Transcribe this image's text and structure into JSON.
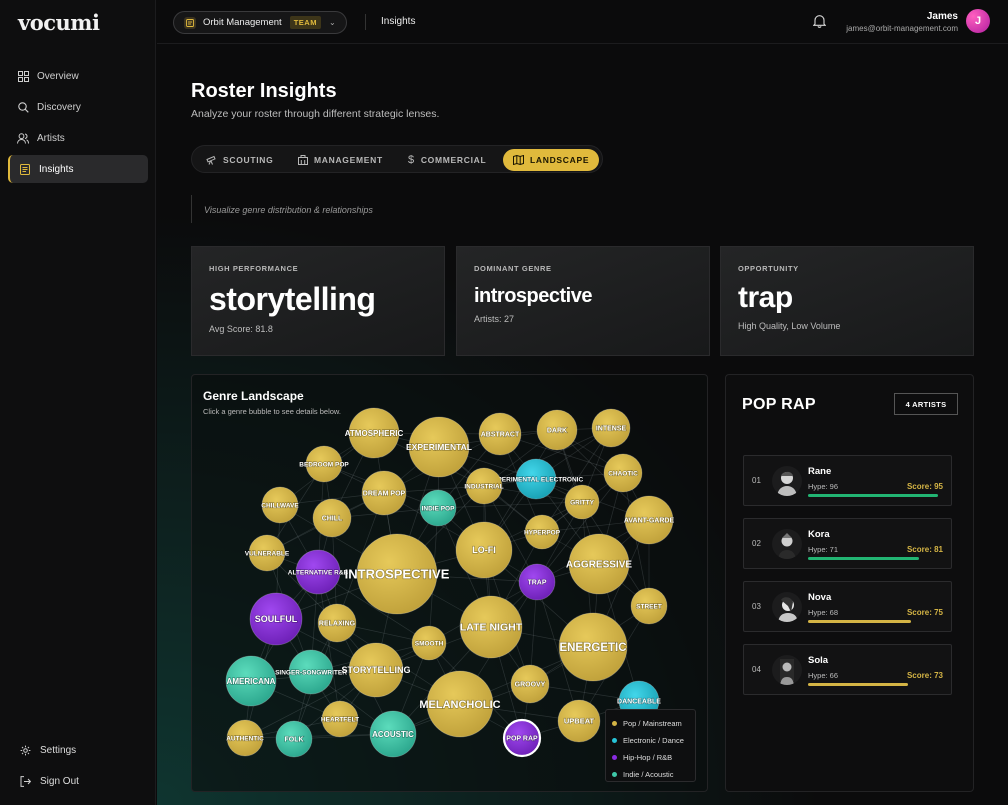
{
  "app": {
    "logo": "vocumi"
  },
  "sidebar": {
    "items": [
      {
        "label": "Overview",
        "icon": "grid-icon"
      },
      {
        "label": "Discovery",
        "icon": "search-icon"
      },
      {
        "label": "Artists",
        "icon": "users-icon"
      },
      {
        "label": "Insights",
        "icon": "document-icon",
        "active": true
      }
    ],
    "settings_label": "Settings",
    "signout_label": "Sign Out"
  },
  "header": {
    "org_name": "Orbit Management",
    "org_badge": "TEAM",
    "breadcrumb": "Insights",
    "user_name": "James",
    "user_email": "james@orbit-management.com",
    "avatar_initial": "J"
  },
  "page": {
    "title": "Roster Insights",
    "subtitle": "Analyze your roster through different strategic lenses.",
    "lens_description": "Visualize genre distribution & relationships"
  },
  "tabs": [
    {
      "label": "SCOUTING",
      "icon": "telescope-icon"
    },
    {
      "label": "MANAGEMENT",
      "icon": "building-icon"
    },
    {
      "label": "COMMERCIAL",
      "icon": "dollar-icon"
    },
    {
      "label": "LANDSCAPE",
      "icon": "map-icon",
      "active": true
    }
  ],
  "stats": [
    {
      "label": "HIGH PERFORMANCE",
      "value": "storytelling",
      "meta": "Avg Score: 81.8"
    },
    {
      "label": "DOMINANT GENRE",
      "value": "introspective",
      "meta": "Artists: 27"
    },
    {
      "label": "OPPORTUNITY",
      "value": "trap",
      "meta": "High Quality, Low Volume"
    }
  ],
  "landscape": {
    "title": "Genre Landscape",
    "subtitle": "Click a genre bubble to see details below.",
    "legend": [
      {
        "label": "Pop / Mainstream",
        "color": "#d4b445"
      },
      {
        "label": "Electronic / Dance",
        "color": "#27c4d8"
      },
      {
        "label": "Hip-Hop / R&B",
        "color": "#8a2be2"
      },
      {
        "label": "Indie / Acoustic",
        "color": "#3fc8a8"
      }
    ],
    "selected": "POP RAP",
    "bubbles": [
      {
        "label": "ATMOSPHERIC",
        "group": "pop"
      },
      {
        "label": "EXPERIMENTAL",
        "group": "pop"
      },
      {
        "label": "ABSTRACT",
        "group": "pop"
      },
      {
        "label": "DARK",
        "group": "pop"
      },
      {
        "label": "INTENSE",
        "group": "pop"
      },
      {
        "label": "BEDROOM POP",
        "group": "pop"
      },
      {
        "label": "EXPERIMENTAL ELECTRONIC",
        "group": "electronic"
      },
      {
        "label": "INDUSTRIAL",
        "group": "pop"
      },
      {
        "label": "CHAOTIC",
        "group": "pop"
      },
      {
        "label": "DREAM POP",
        "group": "pop"
      },
      {
        "label": "CHILLWAVE",
        "group": "pop"
      },
      {
        "label": "CHILL",
        "group": "pop"
      },
      {
        "label": "INDIE POP",
        "group": "indie"
      },
      {
        "label": "GRITTY",
        "group": "pop"
      },
      {
        "label": "AVANT-GARDE",
        "group": "pop"
      },
      {
        "label": "HYPERPOP",
        "group": "pop"
      },
      {
        "label": "LO-FI",
        "group": "pop"
      },
      {
        "label": "VULNERABLE",
        "group": "pop"
      },
      {
        "label": "ALTERNATIVE R&B",
        "group": "hiphop"
      },
      {
        "label": "INTROSPECTIVE",
        "group": "pop"
      },
      {
        "label": "AGGRESSIVE",
        "group": "pop"
      },
      {
        "label": "TRAP",
        "group": "hiphop"
      },
      {
        "label": "SOULFUL",
        "group": "hiphop"
      },
      {
        "label": "RELAXING",
        "group": "pop"
      },
      {
        "label": "STREET",
        "group": "pop"
      },
      {
        "label": "LATE NIGHT",
        "group": "pop"
      },
      {
        "label": "SMOOTH",
        "group": "pop"
      },
      {
        "label": "ENERGETIC",
        "group": "pop"
      },
      {
        "label": "AMERICANA",
        "group": "indie"
      },
      {
        "label": "SINGER-SONGWRITER",
        "group": "indie"
      },
      {
        "label": "STORYTELLING",
        "group": "pop"
      },
      {
        "label": "GROOVY",
        "group": "pop"
      },
      {
        "label": "MELANCHOLIC",
        "group": "pop"
      },
      {
        "label": "DANCEABLE",
        "group": "electronic"
      },
      {
        "label": "HEARTFELT",
        "group": "pop"
      },
      {
        "label": "UPBEAT",
        "group": "pop"
      },
      {
        "label": "ACOUSTIC",
        "group": "indie"
      },
      {
        "label": "AUTHENTIC",
        "group": "pop"
      },
      {
        "label": "FOLK",
        "group": "indie"
      },
      {
        "label": "POP RAP",
        "group": "hiphop"
      }
    ]
  },
  "panel": {
    "title": "POP RAP",
    "count_badge": "4 ARTISTS",
    "artists": [
      {
        "rank": "01",
        "name": "Rane",
        "hype": "Hype: 96",
        "score": "Score: 95",
        "score_value": 95,
        "color": "#22b573"
      },
      {
        "rank": "02",
        "name": "Kora",
        "hype": "Hype: 71",
        "score": "Score: 81",
        "score_value": 81,
        "color": "#22b573"
      },
      {
        "rank": "03",
        "name": "Nova",
        "hype": "Hype: 68",
        "score": "Score: 75",
        "score_value": 75,
        "color": "#d4b445"
      },
      {
        "rank": "04",
        "name": "Sola",
        "hype": "Hype: 66",
        "score": "Score: 73",
        "score_value": 73,
        "color": "#d4b445"
      }
    ]
  }
}
